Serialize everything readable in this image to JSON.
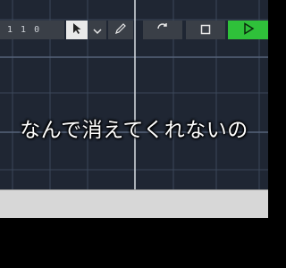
{
  "caption": {
    "text": "なんで消えてくれないの"
  },
  "transport": {
    "position_parts": [
      "1",
      "1",
      "0"
    ]
  },
  "icons": {
    "pointer": "pointer-tool-icon",
    "dropdown": "chevron-down-icon",
    "pencil": "pencil-tool-icon",
    "loop": "loop-icon",
    "stop": "stop-icon",
    "play": "play-icon"
  },
  "colors": {
    "grid_background": "#1f2633",
    "grid_line": "#3b475a",
    "playhead": "#d9dde3",
    "toolbar": "#d7d7d7",
    "play_active": "#2fc13a"
  }
}
